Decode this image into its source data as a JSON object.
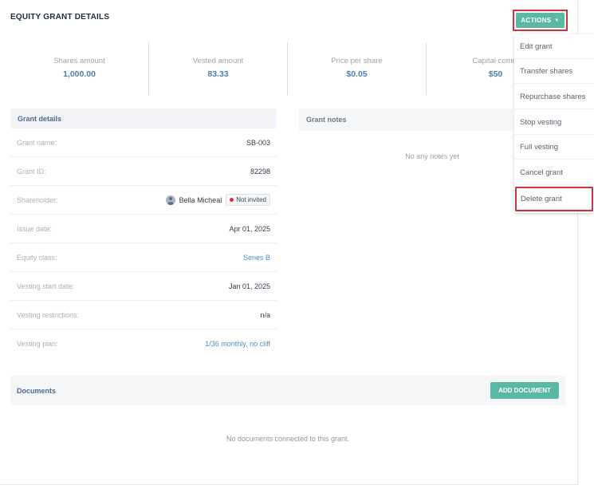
{
  "page": {
    "title": "EQUITY GRANT DETAILS"
  },
  "actions": {
    "button_label": "ACTIONS",
    "menu": [
      "Edit grant",
      "Transfer shares",
      "Repurchase shares",
      "Stop vesting",
      "Full vesting",
      "Cancel grant",
      "Delete grant"
    ]
  },
  "stats": [
    {
      "label": "Shares amount",
      "value": "1,000.00"
    },
    {
      "label": "Vested amount",
      "value": "83.33"
    },
    {
      "label": "Price per share",
      "value": "$0.05"
    },
    {
      "label": "Capital comm",
      "value": "$50"
    }
  ],
  "grant_details": {
    "title": "Grant details",
    "rows": [
      {
        "label": "Grant name:",
        "value": "SB-003"
      },
      {
        "label": "Grant ID:",
        "value": "82298"
      },
      {
        "label": "Shareholder:",
        "value": "Bella Micheal",
        "badge": "Not invited"
      },
      {
        "label": "Issue date:",
        "value": "Apr 01, 2025"
      },
      {
        "label": "Equity class:",
        "value": "Series B"
      },
      {
        "label": "Vesting start date:",
        "value": "Jan 01, 2025"
      },
      {
        "label": "Vesting restrictions:",
        "value": "n/a"
      },
      {
        "label": "Vesting plan:",
        "value": "1/36 monthly, no cliff"
      }
    ]
  },
  "grant_notes": {
    "title": "Grant notes",
    "empty_text": "No any notes yet"
  },
  "documents": {
    "title": "Documents",
    "add_button": "ADD DOCUMENT",
    "empty_text": "No documents connected to this grant."
  },
  "colors": {
    "accent": "#5bb8a5",
    "highlight_border": "#d0323b",
    "link": "#4a8fc6",
    "status_dot": "#d0323b"
  }
}
